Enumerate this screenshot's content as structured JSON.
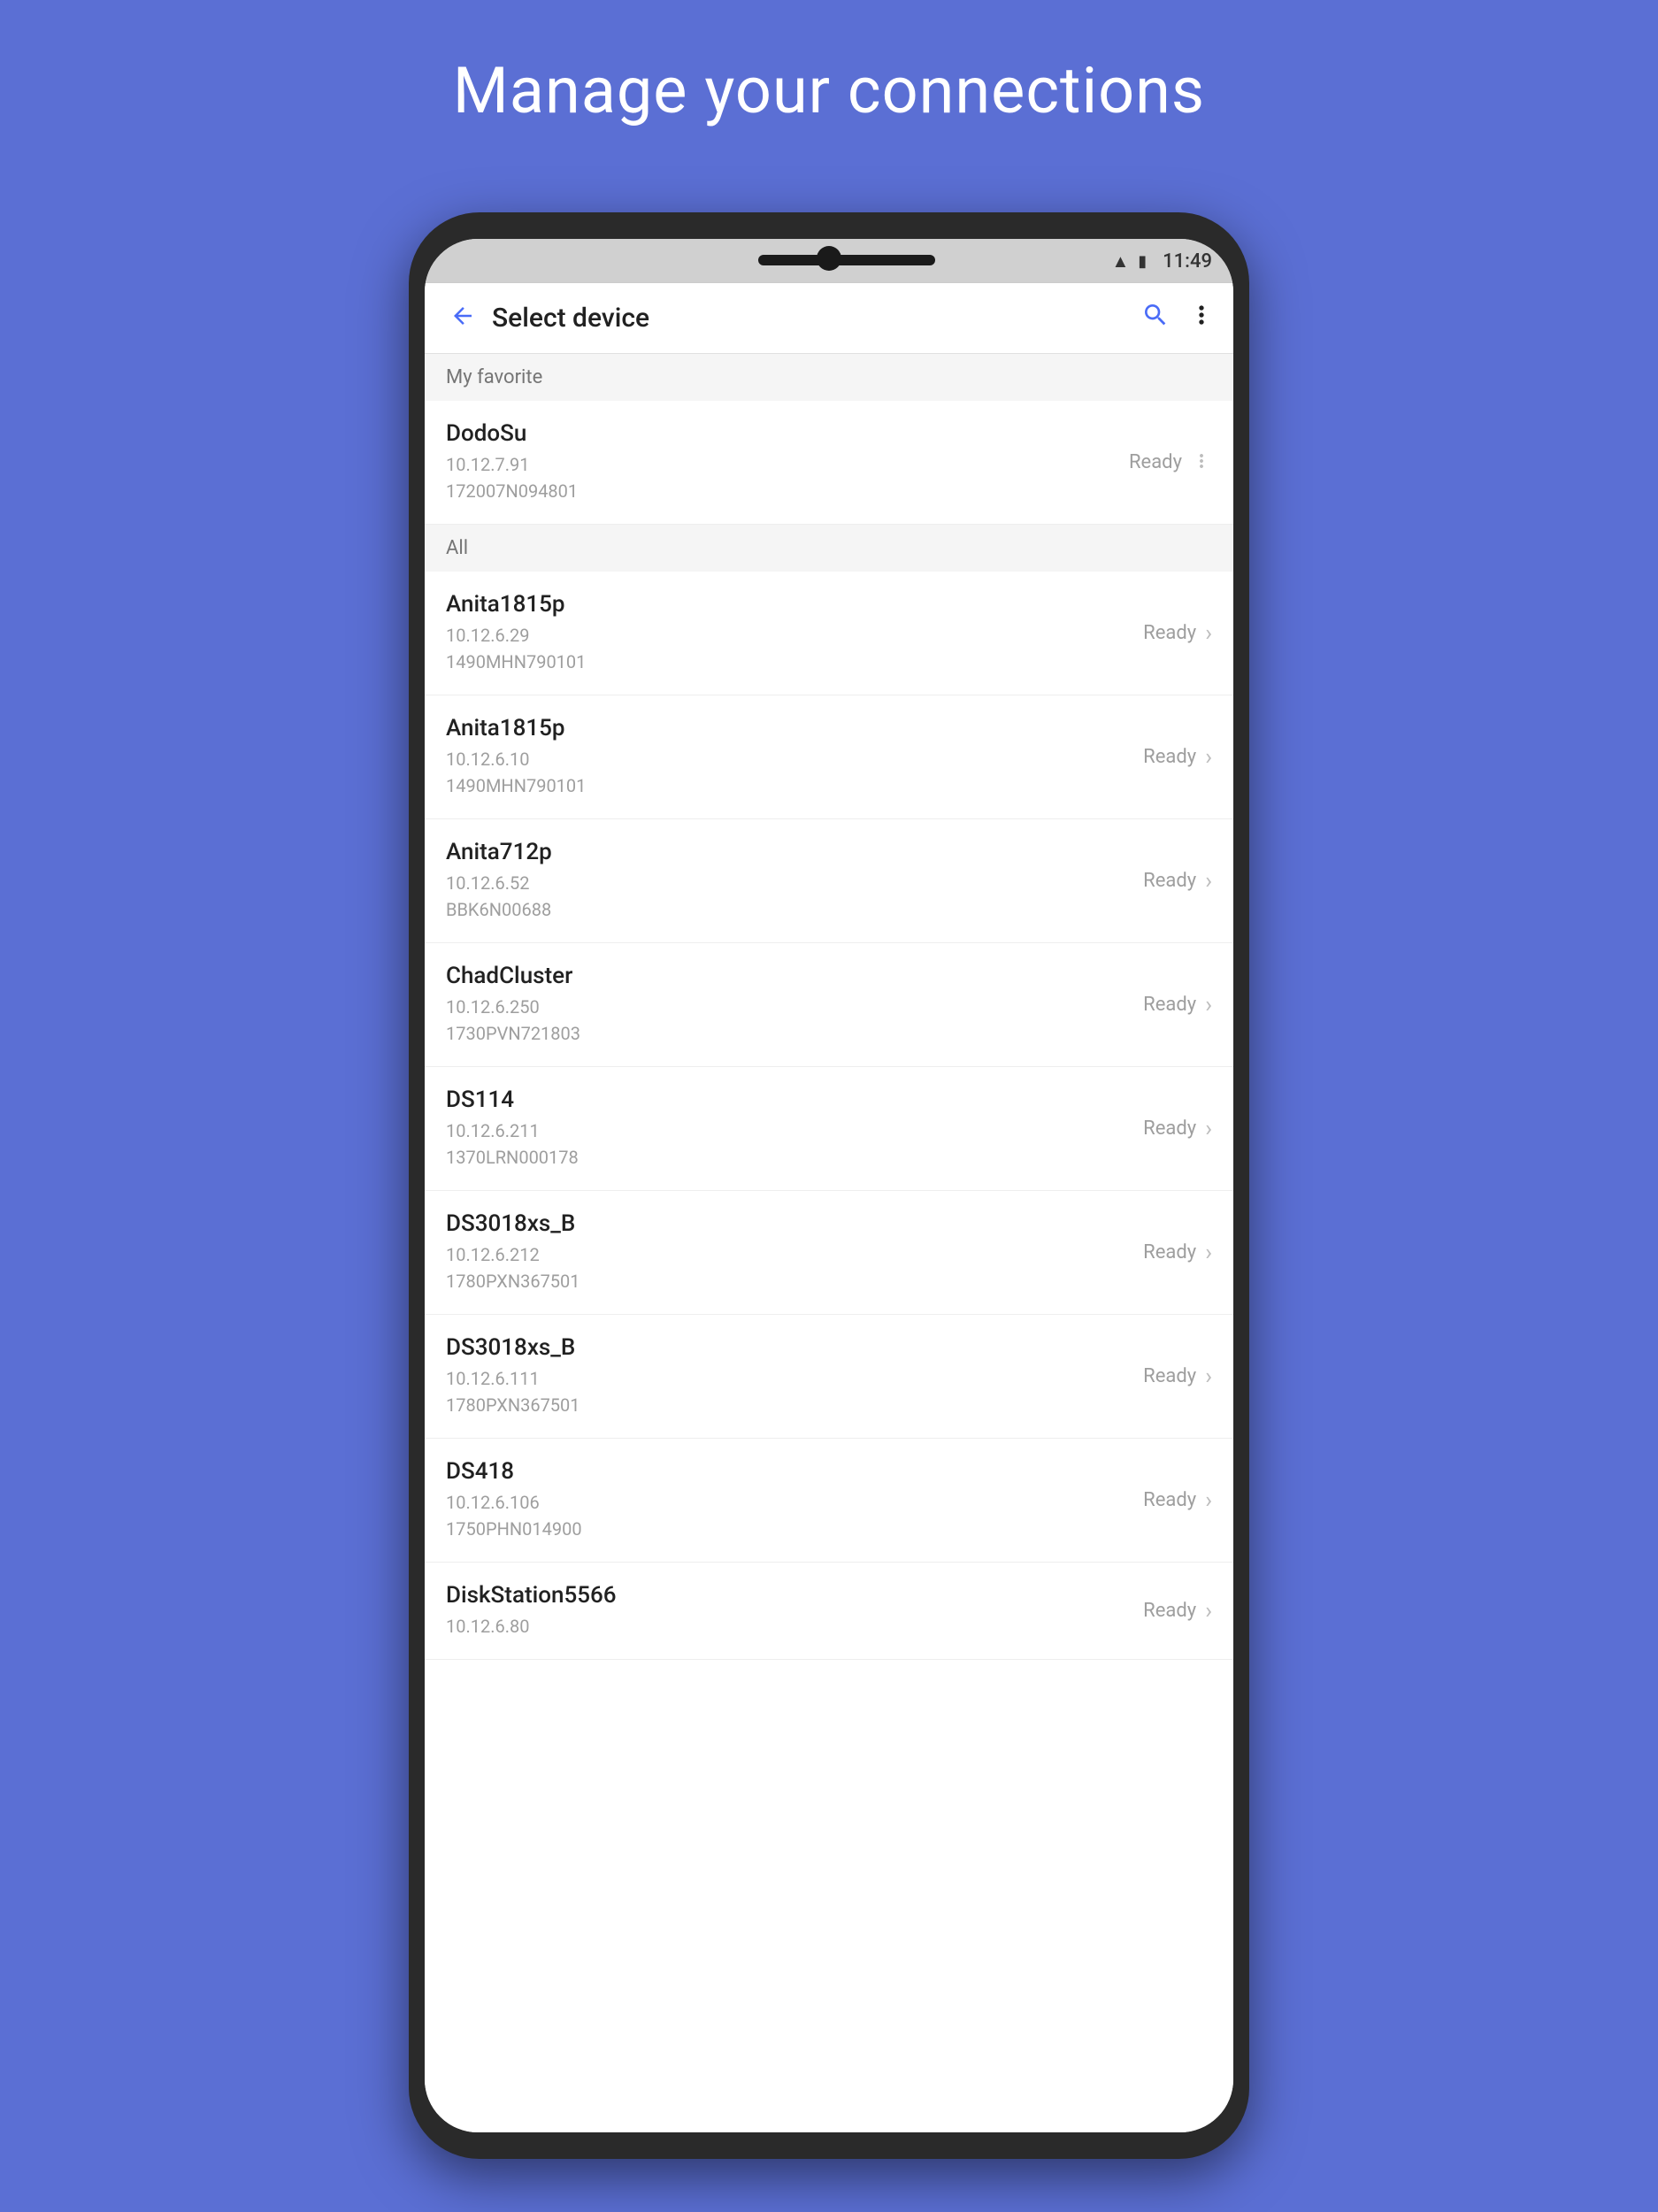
{
  "page": {
    "title": "Manage your connections",
    "background_color": "#5b6fd4"
  },
  "status_bar": {
    "time": "11:49"
  },
  "app_bar": {
    "title": "Select device",
    "back_label": "←"
  },
  "sections": [
    {
      "label": "My favorite",
      "devices": [
        {
          "name": "DodoSu",
          "ip": "10.12.7.91",
          "id": "172007N094801",
          "status": "Ready",
          "has_more": true,
          "has_chevron": false
        }
      ]
    },
    {
      "label": "All",
      "devices": [
        {
          "name": "Anita1815p",
          "ip": "10.12.6.29",
          "id": "1490MHN790101",
          "status": "Ready",
          "has_chevron": true
        },
        {
          "name": "Anita1815p",
          "ip": "10.12.6.10",
          "id": "1490MHN790101",
          "status": "Ready",
          "has_chevron": true
        },
        {
          "name": "Anita712p",
          "ip": "10.12.6.52",
          "id": "BBK6N00688",
          "status": "Ready",
          "has_chevron": true
        },
        {
          "name": "ChadCluster",
          "ip": "10.12.6.250",
          "id": "1730PVN721803",
          "status": "Ready",
          "has_chevron": true
        },
        {
          "name": "DS114",
          "ip": "10.12.6.211",
          "id": "1370LRN000178",
          "status": "Ready",
          "has_chevron": true
        },
        {
          "name": "DS3018xs_B",
          "ip": "10.12.6.212",
          "id": "1780PXN367501",
          "status": "Ready",
          "has_chevron": true
        },
        {
          "name": "DS3018xs_B",
          "ip": "10.12.6.111",
          "id": "1780PXN367501",
          "status": "Ready",
          "has_chevron": true
        },
        {
          "name": "DS418",
          "ip": "10.12.6.106",
          "id": "1750PHN014900",
          "status": "Ready",
          "has_chevron": true
        },
        {
          "name": "DiskStation5566",
          "ip": "10.12.6.80",
          "id": "",
          "status": "Ready",
          "has_chevron": true
        }
      ]
    }
  ]
}
